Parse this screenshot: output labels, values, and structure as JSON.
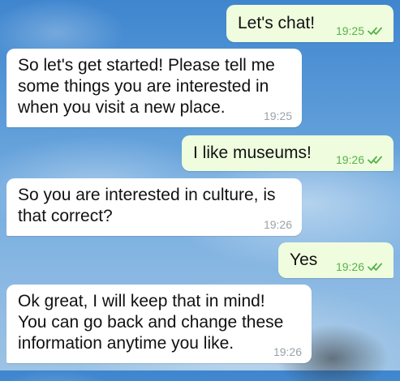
{
  "chat": {
    "messages": [
      {
        "direction": "out",
        "text": "Let's chat!",
        "time": "19:25",
        "status_icon": "double-check-icon"
      },
      {
        "direction": "in",
        "text": "So let's get started! Please tell me\nsome things you are interested in\nwhen you visit a new place.",
        "time": "19:25"
      },
      {
        "direction": "out",
        "text": "I like museums!",
        "time": "19:26",
        "status_icon": "double-check-icon"
      },
      {
        "direction": "in",
        "text": "So you are interested in culture, is\nthat correct?",
        "time": "19:26"
      },
      {
        "direction": "out",
        "text": "Yes",
        "time": "19:26",
        "status_icon": "double-check-icon"
      },
      {
        "direction": "in",
        "text": "Ok great, I will keep that in mind!\nYou can go back and change these\ninformation anytime you like.",
        "time": "19:26"
      }
    ]
  },
  "colors": {
    "outgoing_bubble": "#effdde",
    "incoming_bubble": "#ffffff",
    "outgoing_meta": "#56b24b",
    "incoming_meta": "#9aa3a9"
  }
}
